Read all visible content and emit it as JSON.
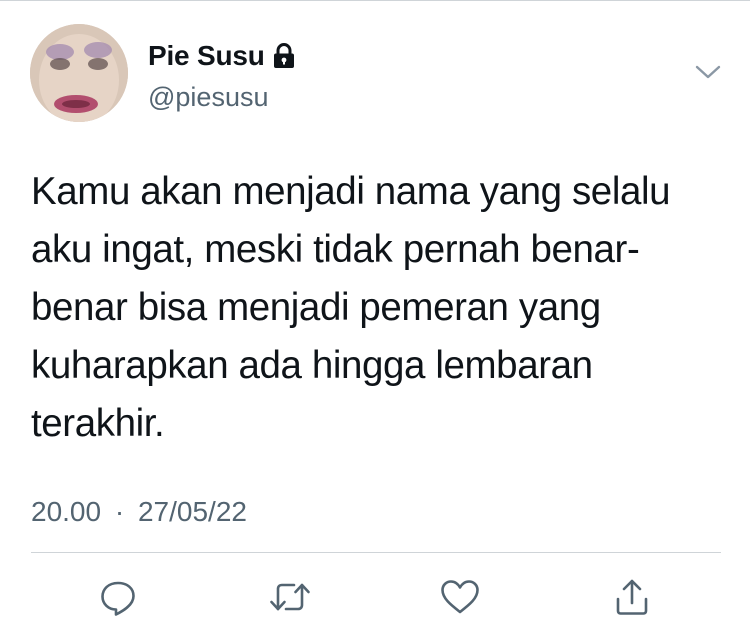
{
  "tweet": {
    "display_name": "Pie Susu",
    "handle": "@piesusu",
    "protected_icon": "lock-icon",
    "text_lines": [
      "Kamu akan menjadi nama yang selalu",
      "aku ingat, meski tidak pernah benar-",
      "benar bisa menjadi pemeran yang",
      "kuharapkan ada hingga lembaran",
      "terakhir."
    ],
    "time": "20.00",
    "date": "27/05/22",
    "separator": "·"
  },
  "actions": [
    {
      "name": "reply",
      "icon": "reply-icon"
    },
    {
      "name": "retweet",
      "icon": "retweet-icon"
    },
    {
      "name": "like",
      "icon": "heart-icon"
    },
    {
      "name": "share",
      "icon": "share-icon"
    }
  ],
  "colors": {
    "text": "#0f1419",
    "secondary": "#536471",
    "divider": "#cfd4d8",
    "background": "#ffffff"
  }
}
